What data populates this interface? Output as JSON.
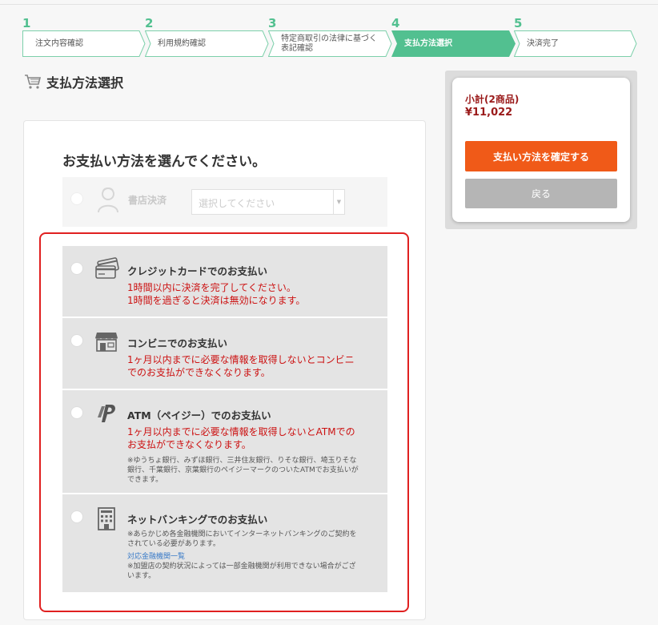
{
  "steps": [
    {
      "number": "1",
      "label": "注文内容確認"
    },
    {
      "number": "2",
      "label": "利用規約確認"
    },
    {
      "number": "3",
      "label_line1": "特定商取引の法律に基づく",
      "label_line2": "表記確認"
    },
    {
      "number": "4",
      "label": "支払方法選択"
    },
    {
      "number": "5",
      "label": "決済完了"
    }
  ],
  "page_title": "支払方法選択",
  "card_heading": "お支払い方法を選んでください。",
  "bookstore": {
    "label": "書店決済",
    "select_placeholder": "選択してください"
  },
  "options": {
    "credit": {
      "title": "クレジットカードでのお支払い",
      "note_line1": "1時間以内に決済を完了してください。",
      "note_line2": "1時間を過ぎると決済は無効になります。"
    },
    "konbini": {
      "title": "コンビニでのお支払い",
      "note_line1": "1ヶ月以内までに必要な情報を取得しないとコンビニ",
      "note_line2": "でのお支払ができなくなります。"
    },
    "atm": {
      "title": "ATM（ペイジー）でのお支払い",
      "note_line1": "1ヶ月以内までに必要な情報を取得しないとATMでの",
      "note_line2": "お支払ができなくなります。",
      "small_line1": "※ゆうちょ銀行、みずほ銀行、三井住友銀行、りそな銀行、埼玉りそな",
      "small_line2": "銀行、千葉銀行、京葉銀行のペイジーマークのついたATMでお支払いが",
      "small_line3": "できます。"
    },
    "netbank": {
      "title": "ネットバンキングでのお支払い",
      "small_line1": "※あらかじめ各金融機関においてインターネットバンキングのご契約を",
      "small_line2": "されている必要があります。",
      "link": "対応金融機関一覧",
      "small_line3": "※加盟店の契約状況によっては一部金融機関が利用できない場合がござ",
      "small_line4": "います。"
    }
  },
  "summary": {
    "subtotal_label": "小計(2商品)",
    "subtotal_value": "¥11,022",
    "confirm_label": "支払い方法を確定する",
    "back_label": "戻る"
  },
  "colors": {
    "step_active": "#52c090",
    "confirm_button": "#f05a18",
    "back_button": "#b5b5b5",
    "highlight_border": "#e02020",
    "note_text": "#cc1111",
    "price_text": "#9a1a1a"
  }
}
